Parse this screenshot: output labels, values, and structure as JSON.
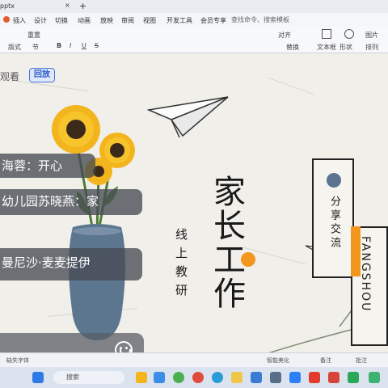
{
  "app": {
    "tab_title": "pptx",
    "new_tab_symbol": "+",
    "close_symbol": "×"
  },
  "menu": {
    "items": [
      "插入",
      "设计",
      "切换",
      "动画",
      "放映",
      "审阅",
      "视图",
      "开发工具",
      "会员专享"
    ],
    "search_placeholder": "查找命令、搜索模板"
  },
  "toolbar": {
    "labels": [
      "重置",
      "版式",
      "节",
      "文本框",
      "形状",
      "排列",
      "图片",
      "对齐",
      "替换"
    ],
    "font_style_glyphs": [
      "B",
      "I",
      "U",
      "S"
    ]
  },
  "live": {
    "viewer_label": "观看",
    "replay_label": "回放",
    "comments": [
      {
        "text": "海蓉：开心"
      },
      {
        "text": "幼儿园苏晓燕：家"
      },
      {
        "text": "曼尼沙·麦麦提伊"
      }
    ],
    "emoji_icon": "smile-icon"
  },
  "slide": {
    "title": "家长工作",
    "subtitle": "线上教研",
    "tag": "分享交流",
    "english": "FANGSHOU",
    "colors": {
      "accent_orange": "#f2961e",
      "dot_blue": "#5a7390",
      "text_dark": "#1a1a1a"
    }
  },
  "statusbar": {
    "left_text": "缺失字体",
    "smart_beautify": "智能美化",
    "notes": "备注",
    "comments": "批注"
  },
  "taskbar": {
    "search_text": "搜索"
  }
}
